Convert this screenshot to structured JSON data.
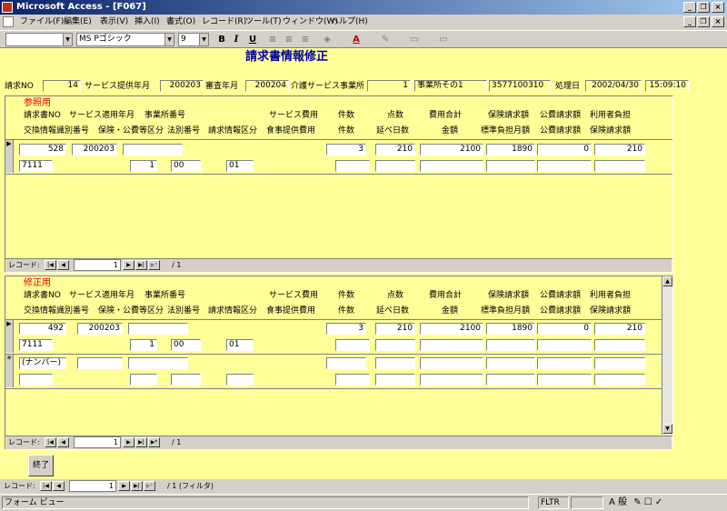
{
  "window": {
    "title": "Microsoft Access - [F067]"
  },
  "menu": [
    "ファイル(F)",
    "編集(E)",
    "表示(V)",
    "挿入(I)",
    "書式(O)",
    "レコード(R)",
    "ツール(T)",
    "ウィンドウ(W)",
    "ヘルプ(H)"
  ],
  "toolbar": {
    "font_name": "MS Pゴシック",
    "font_size": "9",
    "bold": "B",
    "italic": "I",
    "underline": "U"
  },
  "form": {
    "title": "請求書情報修正",
    "header": {
      "claim_no_label": "請求NO",
      "claim_no": "14",
      "service_month_label": "サービス提供年月",
      "service_month": "200203",
      "review_month_label": "審査年月",
      "review_month": "200204",
      "provider_label": "介護サービス事業所",
      "provider_code": "1",
      "provider_name": "事業所その1",
      "provider_no": "3577100310",
      "process_date_label": "処理日",
      "process_date": "2002/04/30",
      "process_time": "15:09:10"
    },
    "columns": {
      "row1": [
        "請求書NO",
        "サービス適用年月",
        "事業所番号",
        "サービス費用",
        "件数",
        "点数",
        "費用合計",
        "保険請求額",
        "公費請求額",
        "利用者負担"
      ],
      "row2": [
        "交換情報識別番号",
        "保険・公費等区分",
        "法別番号",
        "請求情報区分",
        "食事提供費用",
        "件数",
        "延べ日数",
        "金額",
        "標準負担月額",
        "公費請求額",
        "保険請求額"
      ]
    },
    "ref": {
      "title": "参照用",
      "record": {
        "invoice_no": "528",
        "service_month": "200203",
        "count": "3",
        "points": "210",
        "total": "2100",
        "insurance": "1890",
        "public": "0",
        "user_pay": "210",
        "exchange_id": "7111",
        "category": "1",
        "law_no": "00",
        "claim_cat": "01"
      },
      "nav": {
        "label": "レコード:",
        "current": "1",
        "total": "/ 1"
      }
    },
    "mod": {
      "title": "修正用",
      "record": {
        "invoice_no": "492",
        "service_month": "200203",
        "count": "3",
        "points": "210",
        "total": "2100",
        "insurance": "1890",
        "public": "0",
        "user_pay": "210",
        "exchange_id": "7111",
        "category": "1",
        "law_no": "00",
        "claim_cat": "01"
      },
      "new_row_placeholder": "(ナンバー)",
      "nav": {
        "label": "レコード:",
        "current": "1",
        "total": "/ 1"
      }
    },
    "exit_button": "終了",
    "main_nav": {
      "label": "レコード:",
      "current": "1",
      "total": "/ 1 (フィルタ)"
    }
  },
  "status": {
    "text": "フォーム ビュー",
    "filter": "FLTR"
  }
}
